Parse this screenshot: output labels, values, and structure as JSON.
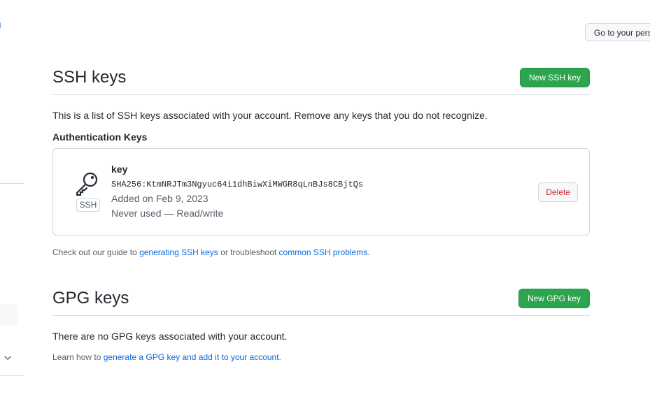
{
  "top": {
    "profile_button": "Go to your pers"
  },
  "ssh": {
    "title": "SSH keys",
    "new_button": "New SSH key",
    "description": "This is a list of SSH keys associated with your account. Remove any keys that you do not recognize.",
    "subheading": "Authentication Keys",
    "keys": [
      {
        "badge": "SSH",
        "title": "key",
        "fingerprint": "SHA256:KtmNRJTm3Ngyuc64i1dhBiwXiMWGR8qLnBJs8CBjtQs",
        "added": "Added on Feb 9, 2023",
        "usage": "Never used — Read/write",
        "delete_label": "Delete"
      }
    ],
    "help": {
      "prefix": "Check out our guide to ",
      "link1": "generating SSH keys",
      "middle": " or troubleshoot ",
      "link2": "common SSH problems",
      "suffix": "."
    }
  },
  "gpg": {
    "title": "GPG keys",
    "new_button": "New GPG key",
    "empty": "There are no GPG keys associated with your account.",
    "help": {
      "prefix": "Learn how to ",
      "link": "generate a GPG key and add it to your account",
      "suffix": "."
    }
  },
  "colors": {
    "primary": "#2da44e",
    "link": "#0969da",
    "danger": "#cf222e"
  }
}
